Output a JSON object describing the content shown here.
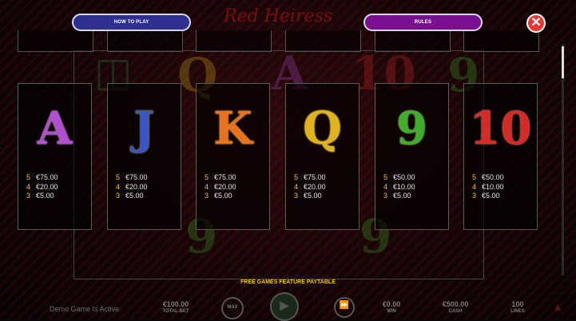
{
  "header": {
    "logo_text": "Red Heiress",
    "how_to_play_label": "HOW TO PLAY",
    "rules_label": "RULES",
    "close_symbol": "✕",
    "how_to_play_color": "#2e2f8f",
    "rules_color": "#7a0f8f"
  },
  "paytable": {
    "symbols": [
      {
        "symbol": "A",
        "color": "#b04fd0",
        "pays": [
          {
            "count": "5",
            "value": "€75.00"
          },
          {
            "count": "4",
            "value": "€20.00"
          },
          {
            "count": "3",
            "value": "€5.00"
          }
        ]
      },
      {
        "symbol": "J",
        "color": "#3a55c8",
        "pays": [
          {
            "count": "5",
            "value": "€75.00"
          },
          {
            "count": "4",
            "value": "€20.00"
          },
          {
            "count": "3",
            "value": "€5.00"
          }
        ]
      },
      {
        "symbol": "K",
        "color": "#e8731c",
        "pays": [
          {
            "count": "5",
            "value": "€75.00"
          },
          {
            "count": "4",
            "value": "€20.00"
          },
          {
            "count": "3",
            "value": "€5.00"
          }
        ]
      },
      {
        "symbol": "Q",
        "color": "#e0b21c",
        "pays": [
          {
            "count": "5",
            "value": "€75.00"
          },
          {
            "count": "4",
            "value": "€20.00"
          },
          {
            "count": "3",
            "value": "€5.00"
          }
        ]
      },
      {
        "symbol": "9",
        "color": "#3fae2a",
        "pays": [
          {
            "count": "5",
            "value": "€50.00"
          },
          {
            "count": "4",
            "value": "€10.00"
          },
          {
            "count": "3",
            "value": "€5.00"
          }
        ]
      },
      {
        "symbol": "10",
        "color": "#d62a26",
        "pays": [
          {
            "count": "5",
            "value": "€50.00"
          },
          {
            "count": "4",
            "value": "€10.00"
          },
          {
            "count": "3",
            "value": "€5.00"
          }
        ]
      }
    ],
    "footer_title": "FREE GAMES FEATURE PAYTABLE"
  },
  "bottom_bar": {
    "demo_text": "Demo Game Is Active",
    "total_bet_value": "€100.00",
    "total_bet_label": "TOTAL BET",
    "max_label": "MAX",
    "win_value": "€0.00",
    "win_label": "WIN",
    "cash_value": "€500.00",
    "cash_label": "CASH",
    "lines_value": "100",
    "lines_label": "LINES"
  }
}
